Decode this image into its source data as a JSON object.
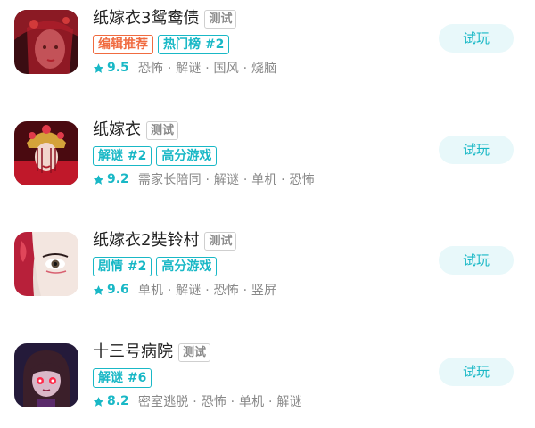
{
  "games": [
    {
      "title": "纸嫁衣3鸳鸯债",
      "badge": "测试",
      "tags": [
        {
          "text": "编辑推荐",
          "color": "orange"
        },
        {
          "text": "热门榜 #2",
          "color": "cyan"
        }
      ],
      "score": "9.5",
      "keywords": "恐怖 · 解谜 · 国风 · 烧脑",
      "button": "试玩",
      "cover_icon": "red-veiled-bride-cover"
    },
    {
      "title": "纸嫁衣",
      "badge": "测试",
      "tags": [
        {
          "text": "解谜 #2",
          "color": "cyan"
        },
        {
          "text": "高分游戏",
          "color": "cyan"
        }
      ],
      "score": "9.2",
      "keywords": "需家长陪同 · 解谜 · 单机 · 恐怖",
      "button": "试玩",
      "cover_icon": "crowned-bride-cover"
    },
    {
      "title": "纸嫁衣2奘铃村",
      "badge": "测试",
      "tags": [
        {
          "text": "剧情 #2",
          "color": "cyan"
        },
        {
          "text": "高分游戏",
          "color": "cyan"
        }
      ],
      "score": "9.6",
      "keywords": "单机 · 解谜 · 恐怖 · 竖屏",
      "button": "试玩",
      "cover_icon": "opera-mask-face-cover"
    },
    {
      "title": "十三号病院",
      "badge": "测试",
      "tags": [
        {
          "text": "解谜 #6",
          "color": "cyan"
        }
      ],
      "score": "8.2",
      "keywords": "密室逃脱 · 恐怖 · 单机 · 解谜",
      "button": "试玩",
      "cover_icon": "red-eyed-girl-cover"
    }
  ],
  "colors": {
    "accent": "#19b8c6",
    "editor_pick": "#f06b40",
    "button_bg": "#e8f8fa"
  }
}
